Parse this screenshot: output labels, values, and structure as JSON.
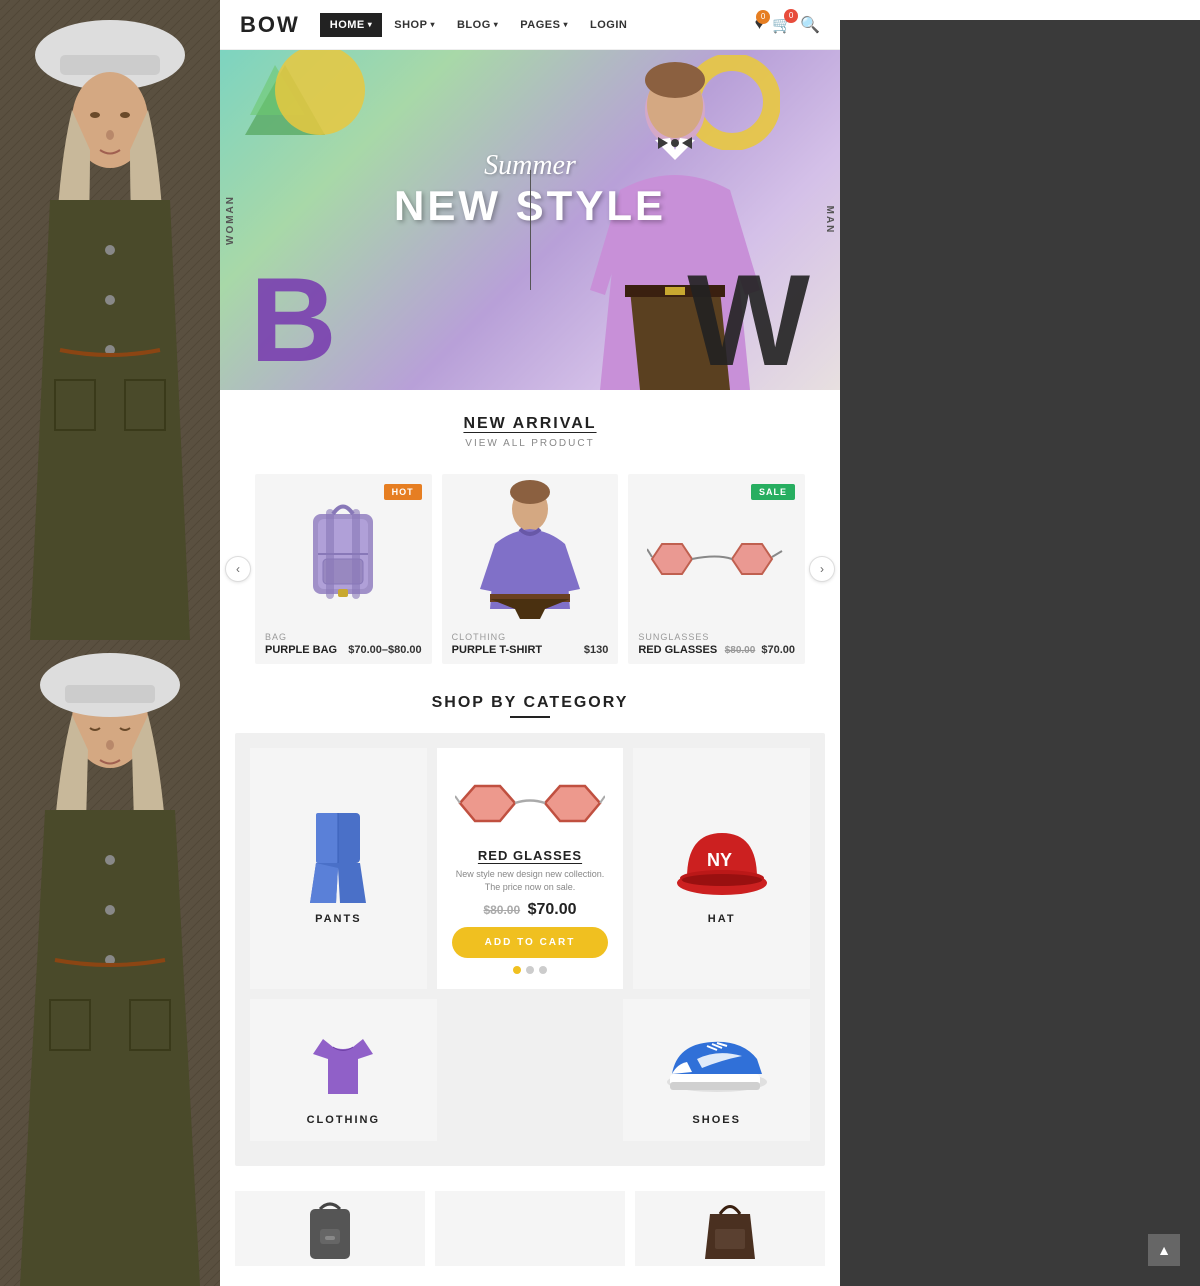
{
  "brand": {
    "name": "BOW"
  },
  "nav": {
    "items": [
      {
        "label": "HOME",
        "active": true
      },
      {
        "label": "SHOP",
        "has_dropdown": true
      },
      {
        "label": "BLOG",
        "has_dropdown": true
      },
      {
        "label": "PAGES",
        "has_dropdown": true
      },
      {
        "label": "LOGIN",
        "has_dropdown": false
      }
    ],
    "wishlist_count": "0",
    "cart_count": "0"
  },
  "hero": {
    "summer_text": "Summer",
    "main_text": "NEW STYLE",
    "woman_label": "WOMAN",
    "man_label": "MAN"
  },
  "new_arrival": {
    "title": "NEW ARRIVAL",
    "subtitle": "VIEW ALL PRODUCT",
    "products": [
      {
        "category": "BAG",
        "name": "PURPLE BAG",
        "price": "$70.00–$80.00",
        "badge": "HOT",
        "badge_type": "hot"
      },
      {
        "category": "CLOTHING",
        "name": "PURPLE T-SHIRT",
        "price": "$130",
        "badge": "",
        "badge_type": ""
      },
      {
        "category": "SUNGLASSES",
        "name": "RED GLASSES",
        "price_old": "$80.00",
        "price_new": "$70.00",
        "badge": "SALE",
        "badge_type": "sale"
      }
    ]
  },
  "shop_category": {
    "title": "SHOP BY CATEGORY",
    "categories": [
      {
        "label": "PANTS"
      },
      {
        "label": "RED GLASSES",
        "featured": true
      },
      {
        "label": "HAT"
      },
      {
        "label": "CLOTHING"
      },
      {
        "label": "SHOES"
      }
    ],
    "featured": {
      "title": "RED GLASSES",
      "description": "New style new design new collection. The price now on sale.",
      "price_old": "$80.00",
      "price_new": "$70.00",
      "add_to_cart_label": "ADD TO CART"
    }
  }
}
